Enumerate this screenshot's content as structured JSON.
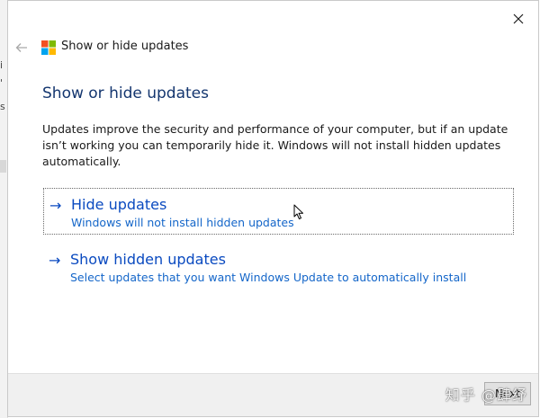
{
  "background_window": {
    "edge_chars": [
      "i",
      "'",
      "s"
    ]
  },
  "dialog": {
    "title": "Show or hide updates",
    "heading": "Show or hide updates",
    "description": "Updates improve the security and performance of your computer, but if an update isn’t working you can temporarily hide it. Windows will not install hidden updates automatically.",
    "options": [
      {
        "title": "Hide updates",
        "subtitle": "Windows will not install hidden updates",
        "arrow": "→",
        "selected": true
      },
      {
        "title": "Show hidden updates",
        "subtitle": "Select updates that you want Windows Update to automatically install",
        "arrow": "→",
        "selected": false
      }
    ],
    "next_label": "Next",
    "icons": {
      "close": "close-icon",
      "back": "back-arrow-icon",
      "logo": "windows-logo-icon",
      "cursor": "mouse-pointer-icon"
    }
  },
  "watermark": "知乎 @肆纾",
  "colors": {
    "heading": "#14366f",
    "link": "#0a4ac0",
    "link_sub": "#1466c9",
    "footer_bg": "#f0f0f0",
    "logo": [
      "#f25022",
      "#7fba00",
      "#00a4ef",
      "#ffb900"
    ]
  }
}
